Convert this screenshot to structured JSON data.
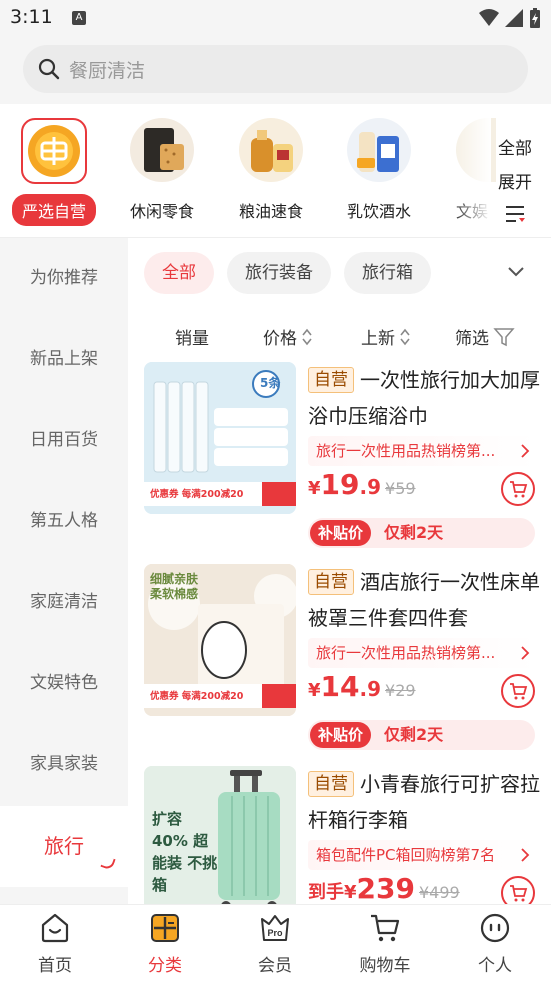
{
  "status_bar": {
    "time": "3:11",
    "a_icon": "A"
  },
  "search": {
    "placeholder": "餐厨清洁"
  },
  "categories": [
    {
      "label": "严选自营",
      "icon": "yanxuan-logo-icon",
      "active": true
    },
    {
      "label": "休闲零食",
      "icon": "snack-icon"
    },
    {
      "label": "粮油速食",
      "icon": "oil-icon"
    },
    {
      "label": "乳饮酒水",
      "icon": "drink-icon"
    },
    {
      "label": "文娱",
      "icon": "stationery-icon"
    }
  ],
  "category_all": {
    "line1": "全部",
    "line2": "展开"
  },
  "sidebar": [
    {
      "label": "为你推荐"
    },
    {
      "label": "新品上架"
    },
    {
      "label": "日用百货"
    },
    {
      "label": "第五人格"
    },
    {
      "label": "家庭清洁"
    },
    {
      "label": "文娱特色"
    },
    {
      "label": "家具家装"
    },
    {
      "label": "旅行",
      "active": true
    }
  ],
  "chips": [
    {
      "label": "全部",
      "active": true
    },
    {
      "label": "旅行装备"
    },
    {
      "label": "旅行箱"
    }
  ],
  "sort": {
    "sales": "销量",
    "price": "价格",
    "newest": "上新",
    "filter": "筛选"
  },
  "products": [
    {
      "badge": "自营",
      "title": "一次性旅行加大加厚浴巾压缩浴巾",
      "rank": "旅行一次性用品热销榜第...",
      "price_int": "19",
      "price_dec": ".9",
      "price_prefix": "",
      "old_price": "¥59",
      "subsidy_tag": "补贴价",
      "subsidy_text": "仅剩2天",
      "image_caption": "优惠券 每满200减20",
      "image_corner": "5条"
    },
    {
      "badge": "自营",
      "title": "酒店旅行一次性床单被罩三件套四件套",
      "rank": "旅行一次性用品热销榜第...",
      "price_int": "14",
      "price_dec": ".9",
      "price_prefix": "",
      "old_price": "¥29",
      "subsidy_tag": "补贴价",
      "subsidy_text": "仅剩2天",
      "image_caption": "优惠券 每满200减20",
      "image_corner": "细腻亲肤 柔软棉感"
    },
    {
      "badge": "自营",
      "title": "小青春旅行可扩容拉杆箱行李箱",
      "rank": "箱包配件PC箱回购榜第7名",
      "price_int": "239",
      "price_dec": "",
      "price_prefix": "到手",
      "old_price": "¥499",
      "image_caption": "扩容 40% 超能装 不挑箱"
    }
  ],
  "tabs": [
    {
      "label": "首页",
      "icon": "home-icon"
    },
    {
      "label": "分类",
      "icon": "category-icon",
      "active": true
    },
    {
      "label": "会员",
      "icon": "pro-member-icon"
    },
    {
      "label": "购物车",
      "icon": "cart-icon"
    },
    {
      "label": "个人",
      "icon": "profile-icon"
    }
  ],
  "colors": {
    "accent": "#e8383c",
    "background": "#f5f5f5"
  }
}
